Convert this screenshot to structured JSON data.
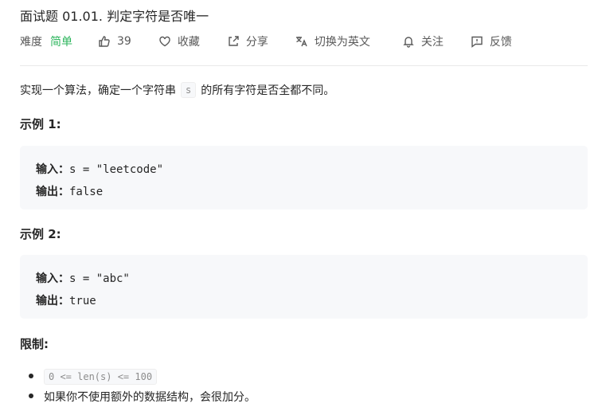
{
  "problem": {
    "title": "面试题 01.01. 判定字符是否唯一"
  },
  "meta": {
    "difficulty_label": "难度",
    "difficulty_value": "简单",
    "like_count": "39",
    "favorite_label": "收藏",
    "share_label": "分享",
    "translate_label": "切换为英文",
    "follow_label": "关注",
    "feedback_label": "反馈",
    "icons": [
      "thumbs-up-icon",
      "heart-icon",
      "share-icon",
      "translate-icon",
      "bell-icon",
      "feedback-icon"
    ],
    "colors": {
      "easy": "#2db55d",
      "text": "#262626",
      "muted": "#595959",
      "code_bg": "#f7f8fa"
    }
  },
  "description": {
    "before": "实现一个算法，确定一个字符串",
    "code": "s",
    "after": "的所有字符是否全都不同。"
  },
  "examples": [
    {
      "heading": "示例 1:",
      "input_label": "输入：",
      "input_value": "s = \"leetcode\"",
      "output_label": "输出：",
      "output_value": "false"
    },
    {
      "heading": "示例 2:",
      "input_label": "输入：",
      "input_value": "s = \"abc\"",
      "output_label": "输出：",
      "output_value": "true"
    }
  ],
  "constraints": {
    "heading": "限制:",
    "items": [
      "0 <= len(s) <= 100",
      "如果你不使用额外的数据结构，会很加分。"
    ]
  }
}
